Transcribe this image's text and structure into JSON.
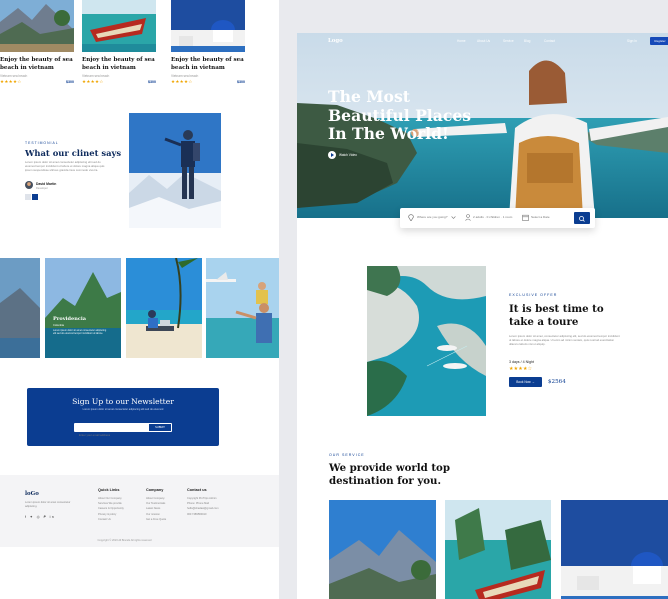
{
  "left_page": {
    "cards": [
      {
        "title": "Enjoy the beauty of sea beach in vietnam",
        "sub": "Vietnam sea beach",
        "rating": "★★★★☆",
        "price": "$300"
      },
      {
        "title": "Enjoy the beauty of sea beach in vietnam",
        "sub": "Vietnam sea beach",
        "rating": "★★★★☆",
        "price": "$300"
      },
      {
        "title": "Enjoy the beauty of sea beach in vietnam",
        "sub": "Vietnam sea beach",
        "rating": "★★★★☆",
        "price": "$300"
      }
    ],
    "testimonial": {
      "label": "TESTIMONIAL",
      "heading": "What our clinet says",
      "body": "Lorem ipsum dolor sit amet consectetur adipiscing elit sed do eiusmod tempor incididunt ut labore et dolore magna aliqua quis ipsum suspendisse ultrices gravida risus commodo viverra.",
      "author": "David Martin",
      "role": "Developer"
    },
    "gallery": {
      "caption_title": "Providencia",
      "caption_sub": "Colombia",
      "caption_desc": "Lorem ipsum dolor sit amet consectetur adipiscing elit sed do eiusmod tempor incididunt ut labore."
    },
    "newsletter": {
      "heading": "Sign Up to our Newsletter",
      "body": "Lorem ipsum dolor sit amet consectetur adipiscing elit sed do eiusmod",
      "placeholder": "Enter your email address",
      "button": "SUBMIT"
    },
    "footer": {
      "logo": "loGo",
      "desc": "Lorem ipsum dolor sit amet consectetur adipiscing.",
      "social": "f  ✦  ◎  ᑭ  in",
      "cols": [
        {
          "title": "Quick Links",
          "items": [
            "About Our Company",
            "Services We provide",
            "Careers & Opportunity",
            "Privacy & policy",
            "Contact Us"
          ]
        },
        {
          "title": "Company",
          "items": [
            "About Company",
            "Our Testimonials",
            "Latest News",
            "Our mission",
            "Get a Free Quote"
          ]
        },
        {
          "title": "Contact us",
          "items": [
            "Copyright ProTrips Admin",
            "Phone: Phone Mail",
            "hello@shadaw@gmail.com",
            "000 7489584910"
          ]
        }
      ],
      "copyright": "Copyright © 2023 All Brands All rights reserved"
    }
  },
  "right_page": {
    "nav": {
      "logo": "Logo",
      "links": [
        "Home",
        "About Us",
        "Service",
        "Blog",
        "Contact"
      ],
      "sign_in": "Sign In",
      "register": "Register"
    },
    "hero": {
      "heading": "The Most Beautiful Places In The World!",
      "watch": "Watch Video"
    },
    "search": {
      "where": "Where are you going?",
      "guests": "2 adults · 0 children · 1 room",
      "date": "Select a Date"
    },
    "offer": {
      "label": "EXCLUSIVE OFFER",
      "heading": "It is best time to take a toure",
      "body": "Lorem ipsum dolor sit amet, consectetur adipiscing elit, sed do eiusmod tempor incididunt ut labore et dolore magna aliqua. Ut enim ad minim veniam, quis nostrud exercitation ullamco laboris nisi ut aliquip.",
      "days": "3 days / 4 Night",
      "rating": "★★★★☆",
      "book": "Book Now",
      "price": "$2564"
    },
    "service": {
      "label": "OUR SERVICE",
      "heading": "We provide world top destination for you."
    }
  },
  "colors": {
    "primary": "#0b3d91",
    "accent_star": "#f0a500",
    "register": "#1649b8"
  },
  "icons": {
    "play": "play-icon",
    "search": "search-icon",
    "location": "location-pin-icon",
    "user": "user-icon",
    "calendar": "calendar-icon",
    "arrow": "arrow-right-icon"
  }
}
